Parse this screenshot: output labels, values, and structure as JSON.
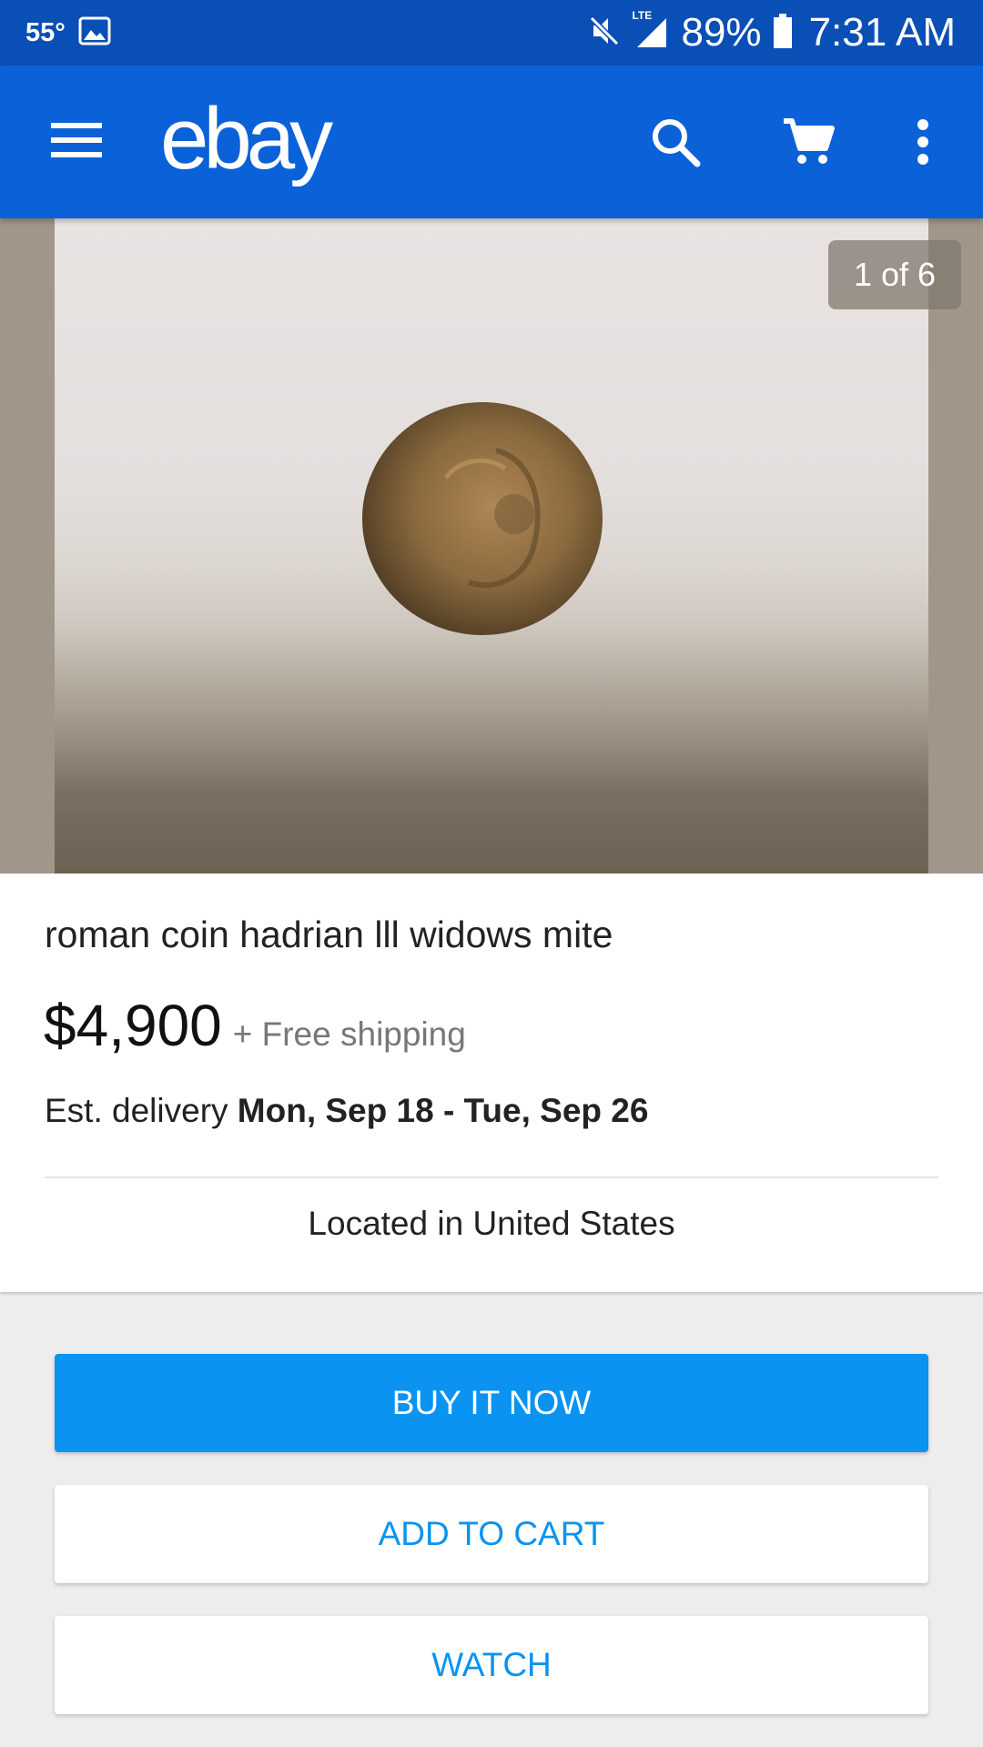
{
  "status_bar": {
    "temperature": "55°",
    "network": "LTE",
    "battery": "89%",
    "time": "7:31 AM"
  },
  "app_bar": {
    "logo_text": "ebay",
    "icons": [
      "menu-icon",
      "search-icon",
      "cart-icon",
      "more-vert-icon"
    ]
  },
  "gallery": {
    "counter": "1 of 6"
  },
  "item": {
    "title": "roman coin hadrian lll widows mite",
    "price": "$4,900",
    "shipping": "+ Free shipping",
    "delivery_label": "Est. delivery",
    "delivery_dates": "Mon, Sep 18 - Tue, Sep 26",
    "location": "Located in United States"
  },
  "actions": {
    "buy_now": "BUY IT NOW",
    "add_to_cart": "ADD TO CART",
    "watch": "WATCH"
  },
  "colors": {
    "status_bar": "#0a4fb5",
    "app_bar": "#0b61d8",
    "accent": "#0a93f0"
  }
}
